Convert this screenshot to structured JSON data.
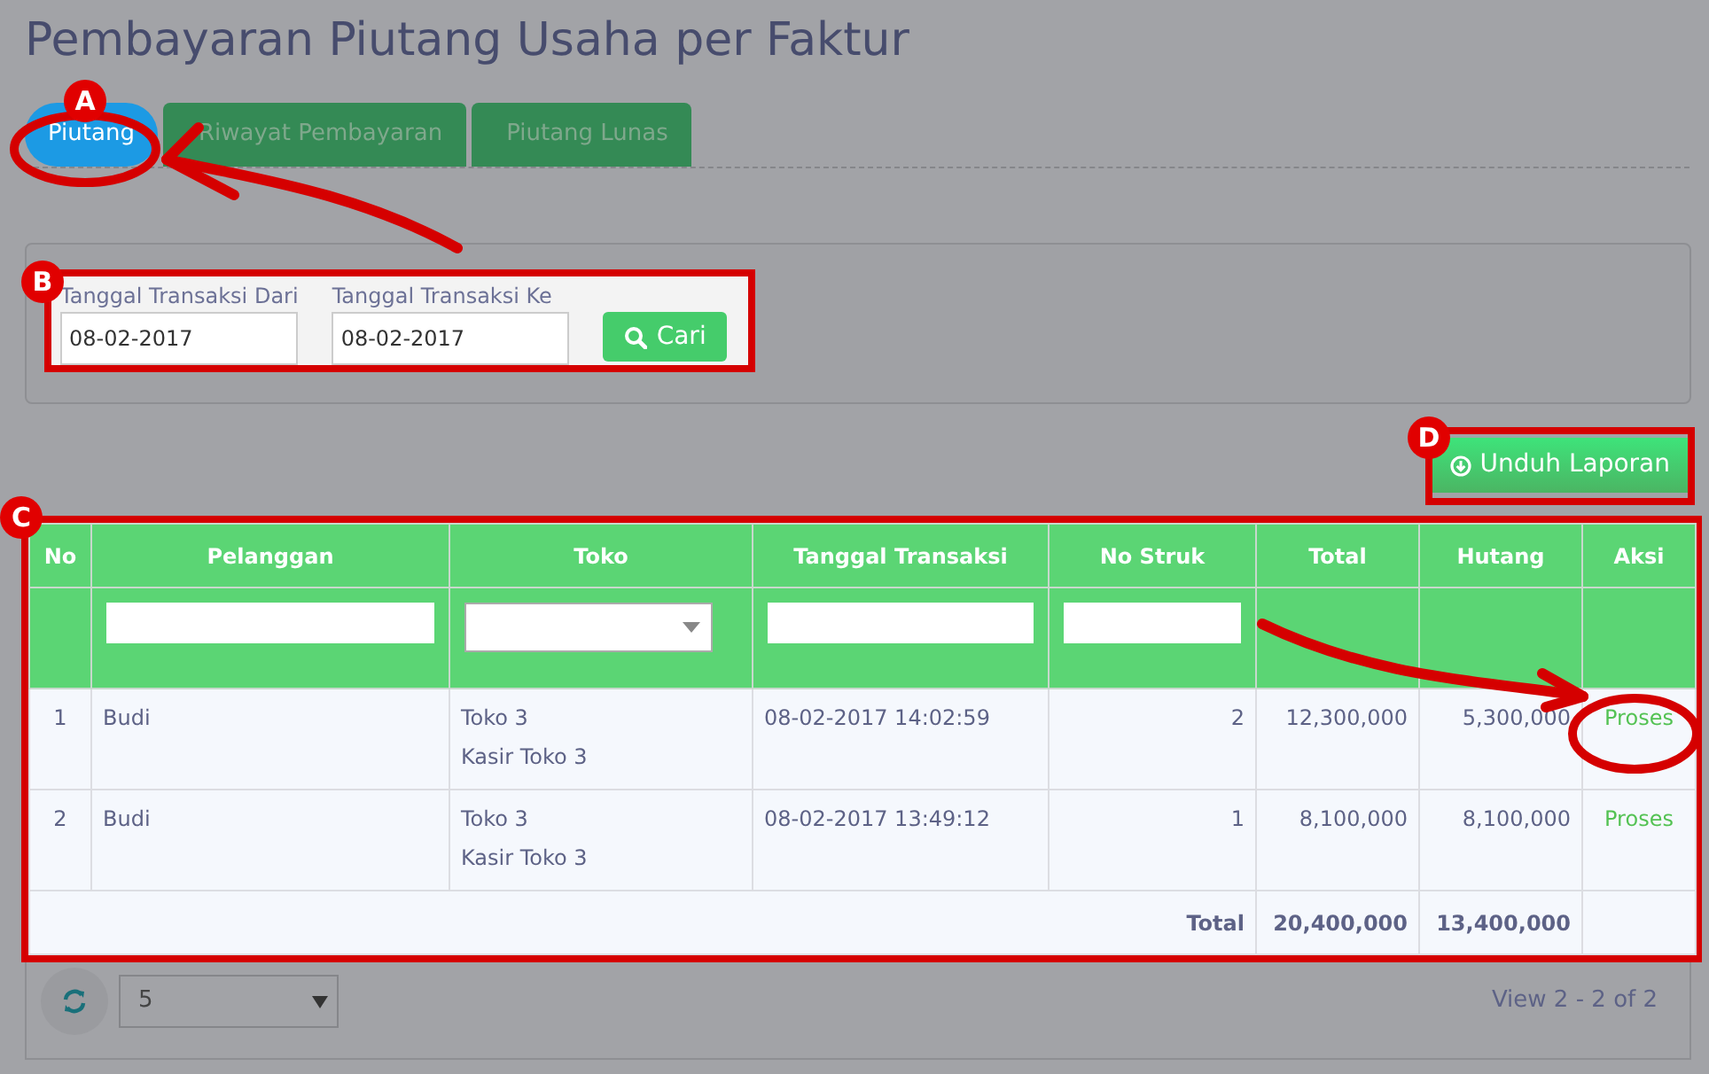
{
  "title": "Pembayaran Piutang Usaha per Faktur",
  "tabs": [
    {
      "label": "Piutang",
      "selected": true
    },
    {
      "label": "Riwayat Pembayaran",
      "selected": false
    },
    {
      "label": "Piutang Lunas",
      "selected": false
    }
  ],
  "filter": {
    "fields": [
      {
        "label": "Tanggal Transaksi Dari",
        "value": "08-02-2017"
      },
      {
        "label": "Tanggal Transaksi Ke",
        "value": "08-02-2017"
      }
    ],
    "search_button": "Cari"
  },
  "download_button": "Unduh Laporan",
  "table": {
    "columns": [
      "No",
      "Pelanggan",
      "Toko",
      "Tanggal Transaksi",
      "No Struk",
      "Total",
      "Hutang",
      "Aksi"
    ],
    "filter_row": [
      {
        "kind": "empty"
      },
      {
        "kind": "text"
      },
      {
        "kind": "select"
      },
      {
        "kind": "text"
      },
      {
        "kind": "text"
      },
      {
        "kind": "empty"
      },
      {
        "kind": "empty"
      },
      {
        "kind": "empty"
      }
    ],
    "rows": [
      {
        "no": "1",
        "customer": "Budi",
        "store": [
          "Toko 3",
          "Kasir Toko 3"
        ],
        "date": "08-02-2017 14:02:59",
        "receipt": "2",
        "total": "12,300,000",
        "debt": "5,300,000",
        "action": "Proses"
      },
      {
        "no": "2",
        "customer": "Budi",
        "store": [
          "Toko 3",
          "Kasir Toko 3"
        ],
        "date": "08-02-2017 13:49:12",
        "receipt": "1",
        "total": "8,100,000",
        "debt": "8,100,000",
        "action": "Proses"
      }
    ],
    "totals": {
      "label": "Total",
      "total": "20,400,000",
      "debt": "13,400,000"
    }
  },
  "pager": {
    "page_size": "5",
    "summary": "View 2 - 2 of 2"
  },
  "annotations": [
    {
      "label": "A"
    },
    {
      "label": "B"
    },
    {
      "label": "C"
    },
    {
      "label": "D"
    }
  ]
}
